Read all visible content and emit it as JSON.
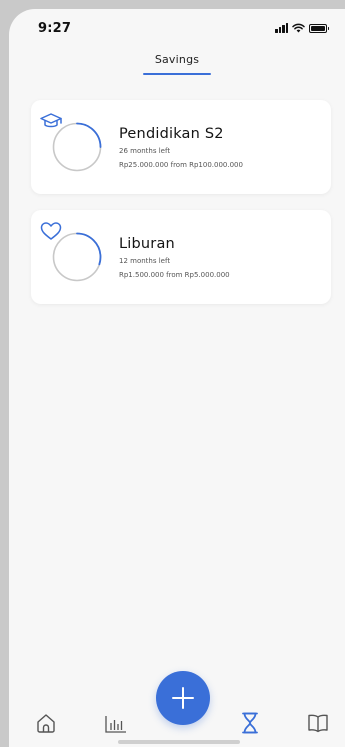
{
  "status_bar": {
    "time": "9:27"
  },
  "header": {
    "title": "Savings"
  },
  "savings": [
    {
      "title": "Pendidikan S2",
      "months_left": "26 months left",
      "amount": "Rp25.000.000 from Rp100.000.000",
      "progress": 0.25,
      "icon": "graduation-cap-icon"
    },
    {
      "title": "Liburan",
      "months_left": "12 months left",
      "amount": "Rp1.500.000 from Rp5.000.000",
      "progress": 0.3,
      "icon": "heart-icon"
    }
  ],
  "nav": {
    "items": [
      "home-icon",
      "chart-icon",
      "add-icon",
      "hourglass-icon",
      "book-icon"
    ],
    "active": "hourglass-icon"
  },
  "colors": {
    "accent": "#3a6fd8",
    "ring_track": "#c8c8c8",
    "background": "#f7f7f7"
  }
}
